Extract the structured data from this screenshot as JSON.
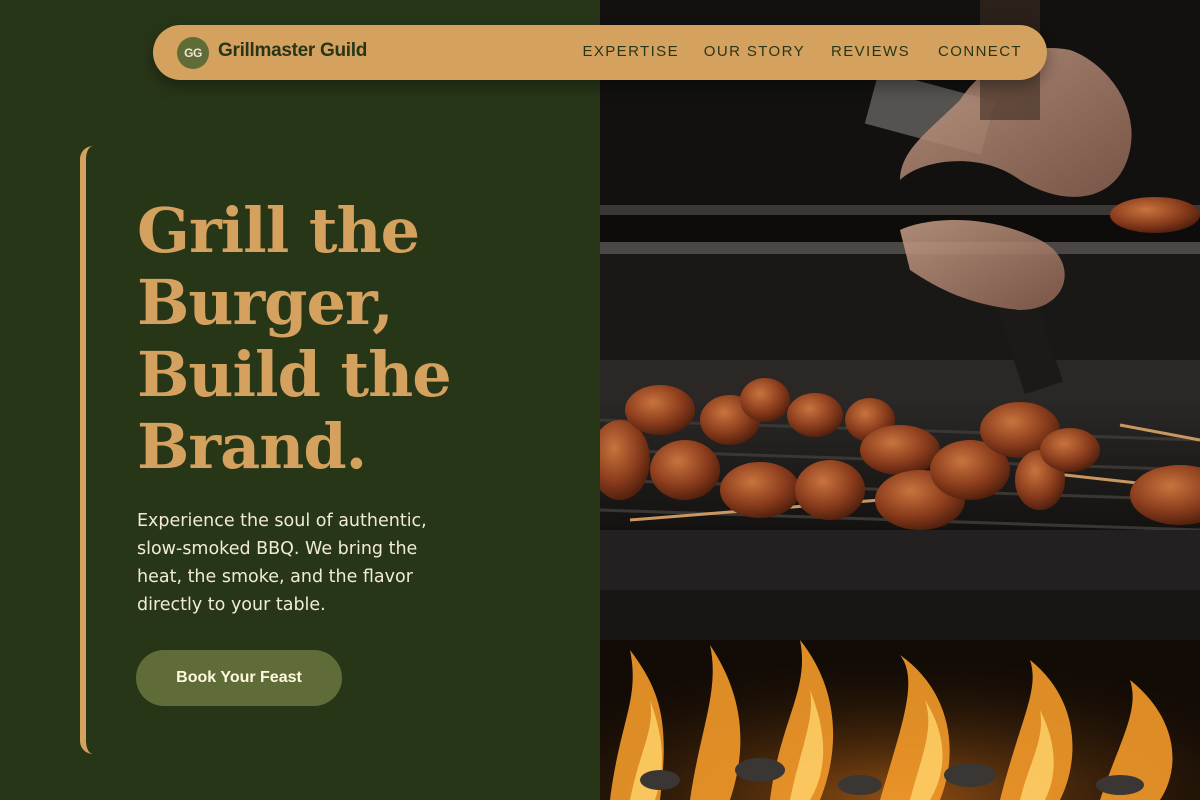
{
  "nav": {
    "logo_initials": "GG",
    "brand": "Grillmaster Guild",
    "links": [
      "EXPERTISE",
      "OUR STORY",
      "REVIEWS",
      "CONNECT"
    ]
  },
  "hero": {
    "headline_lines": [
      "Grill the",
      "Burger,",
      "Build the",
      "Brand."
    ],
    "subtext_lines": [
      "Experience the soul of authentic,",
      "slow-smoked BBQ. We bring the",
      "heat, the smoke, and the flavor",
      "directly to your table."
    ],
    "cta_label": "Book Your Feast"
  },
  "image": {
    "subject": "grill-with-meat-skewers-and-flames"
  },
  "colors": {
    "background": "#283618",
    "accent": "#d4a15e",
    "button": "#606c38",
    "text_light": "#f1ead8"
  }
}
